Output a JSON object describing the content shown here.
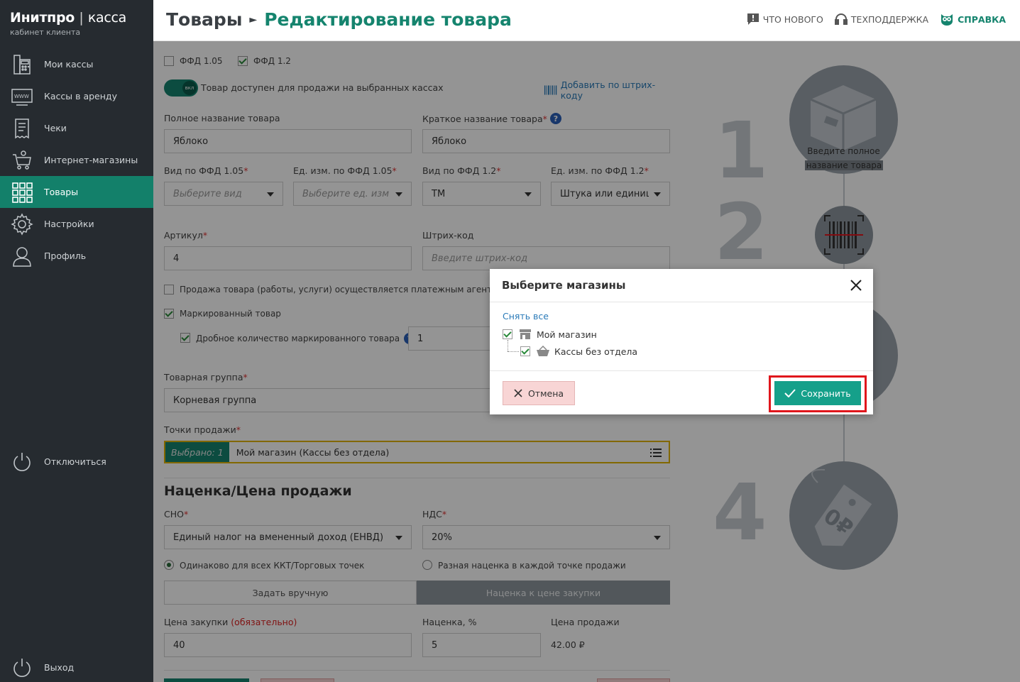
{
  "brand": {
    "name": "Инитпро",
    "separator": "|",
    "product": "касса",
    "subtitle": "кабинет клиента"
  },
  "sidebar": {
    "items": [
      {
        "label": "Мои кассы",
        "icon": "cash-register-icon"
      },
      {
        "label": "Кассы в аренду",
        "icon": "www-icon"
      },
      {
        "label": "Чеки",
        "icon": "receipt-icon"
      },
      {
        "label": "Интернет-магазины",
        "icon": "cart-icon"
      },
      {
        "label": "Товары",
        "icon": "grid-icon",
        "active": true
      },
      {
        "label": "Настройки",
        "icon": "gear-icon"
      },
      {
        "label": "Профиль",
        "icon": "user-icon"
      }
    ],
    "disconnect": "Отключиться",
    "logout": "Выход"
  },
  "header": {
    "crumb_root": "Товары",
    "crumb_current": "Редактирование товара",
    "whats_new": "ЧТО НОВОГО",
    "support": "ТЕХПОДДЕРЖКА",
    "help": "СПРАВКА"
  },
  "form": {
    "ffd105": "ФФД 1.05",
    "ffd12": "ФФД 1.2",
    "toggle_knob": "вкл",
    "toggle_label": "Товар доступен для продажи на выбранных кассах",
    "add_barcode": "Добавить по штрих-коду",
    "full_name_label": "Полное название товара",
    "full_name_value": "Яблоко",
    "short_name_label": "Краткое название товара",
    "short_name_value": "Яблоко",
    "kind105_label": "Вид по ФФД 1.05",
    "kind105_ph": "Выберите вид",
    "unit105_label": "Ед. изм. по ФФД 1.05",
    "unit105_ph": "Выберите ед. изм",
    "kind12_label": "Вид по ФФД 1.2",
    "kind12_value": "ТМ",
    "unit12_label": "Ед. изм. по ФФД 1.2",
    "unit12_value": "Штука или единиц",
    "article_label": "Артикул",
    "article_value": "4",
    "barcode_label": "Штрих-код",
    "barcode_ph": "Введите штрих-код",
    "agent_label": "Продажа товара (работы, услуги) осуществляется платежным агентом",
    "marked_label": "Маркированный товар",
    "fraction_label": "Дробное количество маркированного товара",
    "fraction_value": "1",
    "group_label": "Товарная группа",
    "group_value": "Корневая группа",
    "points_label": "Точки продажи",
    "points_badge": "Выбрано: 1",
    "points_value": "Мой магазин (Кассы без отдела)",
    "markup_heading": "Наценка/Цена продажи",
    "sno_label": "СНО",
    "sno_value": "Единый налог на вмененный доход (ЕНВД)",
    "nds_label": "НДС",
    "nds_value": "20%",
    "radio_same": "Одинаково для всех ККТ/Торговых точек",
    "radio_diff": "Разная наценка в каждой точке продажи",
    "seg_manual": "Задать вручную",
    "seg_markup": "Наценка к цене закупки",
    "buy_price_label": "Цена закупки",
    "buy_price_req": "(обязательно)",
    "buy_price_value": "40",
    "markup_pct_label": "Наценка, %",
    "markup_pct_value": "5",
    "sale_price_label": "Цена продажи",
    "sale_price_value": "42.00 ₽"
  },
  "steps": {
    "n1": "1",
    "n2": "2",
    "n4": "4",
    "step1_line1": "Введите полное",
    "step1_line2": "название товара"
  },
  "modal": {
    "title": "Выберите магазины",
    "deselect_all": "Снять все",
    "store": "Мой магазин",
    "department": "Кассы без отдела",
    "cancel": "Отмена",
    "save": "Сохранить"
  },
  "colors": {
    "accent": "#15846e",
    "sidebar": "#262b30",
    "highlight": "#e0161c"
  }
}
